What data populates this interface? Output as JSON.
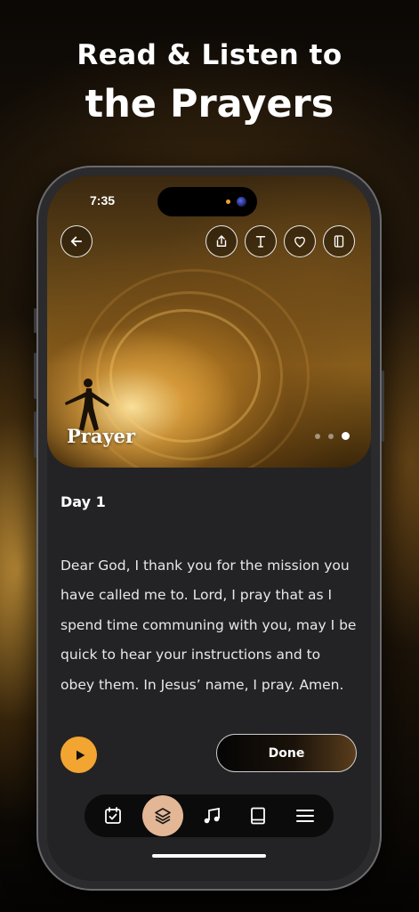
{
  "headline": {
    "line1": "Read & Listen to",
    "line2": "the Prayers"
  },
  "status_bar": {
    "time": "7:35"
  },
  "hero": {
    "title": "Prayer",
    "carousel": {
      "count": 3,
      "active_index": 2
    },
    "actions": [
      "share-icon",
      "text-size-icon",
      "heart-icon",
      "journal-icon"
    ]
  },
  "content": {
    "day_label": "Day 1",
    "prayer_text": "Dear God, I thank you for the mission you have called me to. Lord, I pray that as I spend time communing with you, may I be quick to hear your instructions and to obey them. In Jesus’ name, I pray. Amen."
  },
  "controls": {
    "done_label": "Done"
  },
  "tabbar": {
    "items": [
      "calendar-check-icon",
      "layers-icon",
      "music-icon",
      "book-icon",
      "menu-icon"
    ],
    "active_index": 1
  },
  "colors": {
    "accent": "#f3a531",
    "active_tab": "#e3b796",
    "background": "#232325"
  }
}
